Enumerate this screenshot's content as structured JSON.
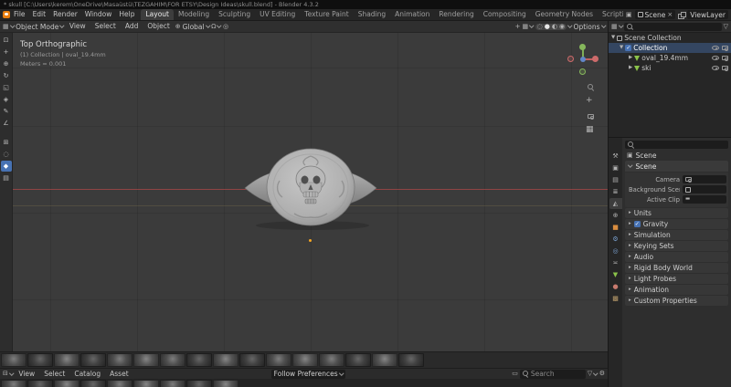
{
  "colors": {
    "accent": "#4772b3",
    "axis_x": "#ac4848",
    "mesh_green": "#8bc34a",
    "blender_orange": "#e87d0d"
  },
  "icons": {
    "search": "magnifier",
    "filter": "funnel",
    "gear": "⚙",
    "eye": "eye-shape",
    "camera": "camera-shape",
    "close": "×"
  },
  "titlebar": {
    "title": "* skull [C:\\Users\\kerem\\OneDrive\\Masaüstü\\TEZGAHIM\\FOR ETSY\\Design Ideas\\skull.blend] - Blender 4.3.2"
  },
  "topbar": {
    "menus": [
      "File",
      "Edit",
      "Render",
      "Window",
      "Help"
    ],
    "workspaces": [
      "Layout",
      "Modeling",
      "Sculpting",
      "UV Editing",
      "Texture Paint",
      "Shading",
      "Animation",
      "Rendering",
      "Compositing",
      "Geometry Nodes",
      "Scripting"
    ],
    "active_workspace": "Layout",
    "scene_name": "Scene",
    "viewlayer_name": "ViewLayer"
  },
  "viewport_header": {
    "mode": "Object Mode",
    "menus": [
      "View",
      "Select",
      "Add",
      "Object"
    ],
    "orientation": "Global",
    "options": "Options"
  },
  "viewport_overlay": {
    "line1": "Top Orthographic",
    "line2": "(1) Collection | oval_19.4mm",
    "line3": "Meters = 0.001"
  },
  "outliner": {
    "rows": [
      {
        "label": "Scene Collection"
      },
      {
        "label": "Collection"
      },
      {
        "label": "oval_19.4mm"
      },
      {
        "label": "ski"
      }
    ]
  },
  "properties": {
    "breadcrumb": "Scene",
    "scene_section": {
      "title": "Scene",
      "rows": [
        {
          "label": "Camera"
        },
        {
          "label": "Background Scene"
        },
        {
          "label": "Active Clip"
        }
      ]
    },
    "sections": [
      "Units",
      "Gravity",
      "Simulation",
      "Keying Sets",
      "Audio",
      "Rigid Body World",
      "Light Probes",
      "Animation",
      "Custom Properties"
    ]
  },
  "asset_browser": {
    "menus": [
      "View",
      "Select",
      "Catalog",
      "Asset"
    ],
    "import_method": "Follow Preferences",
    "search_placeholder": "Search"
  }
}
